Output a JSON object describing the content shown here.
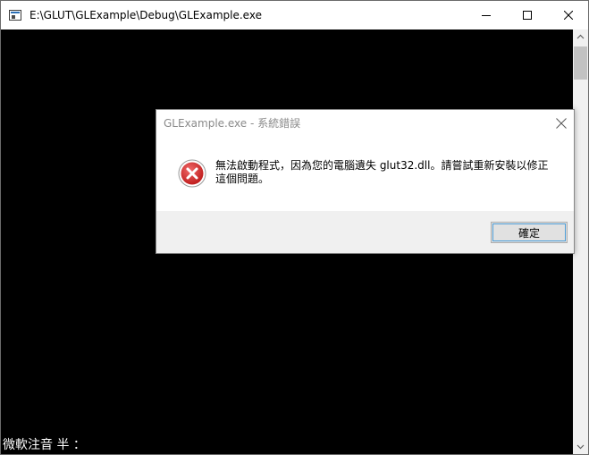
{
  "window": {
    "title": "E:\\GLUT\\GLExample\\Debug\\GLExample.exe",
    "ime_status": "微軟注音 半 ："
  },
  "dialog": {
    "title": "GLExample.exe - 系統錯誤",
    "message": "無法啟動程式，因為您的電腦遺失 glut32.dll。請嘗試重新安裝以修正這個問題。",
    "ok_label": "確定"
  },
  "colors": {
    "console_background": "#000000",
    "error_icon": "#d02c2c",
    "button_focus": "#4e9ed8"
  }
}
